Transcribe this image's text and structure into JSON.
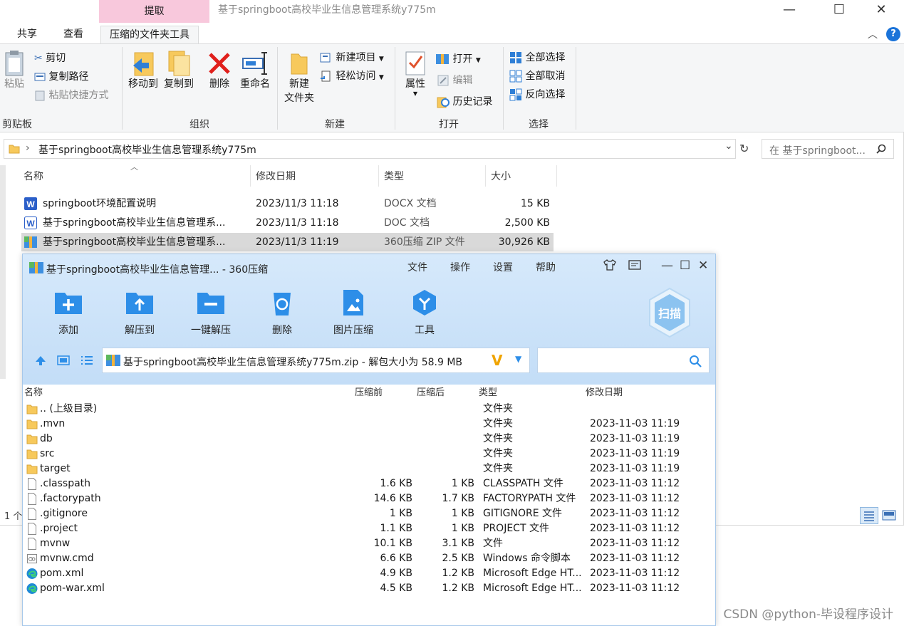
{
  "explorer": {
    "context_tab": "提取",
    "title": "基于springboot高校毕业生信息管理系统y775m",
    "tabs": [
      "共享",
      "查看",
      "压缩的文件夹工具"
    ],
    "ribbon": {
      "clipboard": {
        "label": "剪贴板",
        "paste": "粘贴",
        "cut": "剪切",
        "copy_path": "复制路径",
        "paste_shortcut": "粘贴快捷方式"
      },
      "organize": {
        "label": "组织",
        "move_to": "移动到",
        "copy_to": "复制到",
        "delete": "删除",
        "rename": "重命名"
      },
      "new": {
        "label": "新建",
        "new_folder_1": "新建",
        "new_folder_2": "文件夹",
        "new_item": "新建项目",
        "easy_access": "轻松访问"
      },
      "open": {
        "label": "打开",
        "properties": "属性",
        "open": "打开",
        "edit": "编辑",
        "history": "历史记录"
      },
      "select": {
        "label": "选择",
        "select_all": "全部选择",
        "select_none": "全部取消",
        "invert": "反向选择"
      }
    },
    "address": "基于springboot高校毕业生信息管理系统y775m",
    "search_placeholder": "在 基于springboot...",
    "columns": [
      "名称",
      "修改日期",
      "类型",
      "大小"
    ],
    "files": [
      {
        "name": "springboot环境配置说明",
        "date": "2023/11/3 11:18",
        "type": "DOCX 文档",
        "size": "15 KB"
      },
      {
        "name": "基于springboot高校毕业生信息管理系...",
        "date": "2023/11/3 11:18",
        "type": "DOC 文档",
        "size": "2,500 KB"
      },
      {
        "name": "基于springboot高校毕业生信息管理系...",
        "date": "2023/11/3 11:19",
        "type": "360压缩 ZIP 文件",
        "size": "30,926 KB"
      }
    ],
    "status": "1 个"
  },
  "zip": {
    "title": "基于springboot高校毕业生信息管理... - 360压缩",
    "menu": [
      "文件",
      "操作",
      "设置",
      "帮助"
    ],
    "tools": [
      "添加",
      "解压到",
      "一键解压",
      "删除",
      "图片压缩",
      "工具"
    ],
    "scan": "扫描",
    "path": "基于springboot高校毕业生信息管理系统y775m.zip - 解包大小为 58.9 MB",
    "columns": [
      "名称",
      "压缩前",
      "压缩后",
      "类型",
      "修改日期"
    ],
    "rows": [
      {
        "icon": "folder",
        "name": ".. (上级目录)",
        "before": "",
        "after": "",
        "type": "文件夹",
        "date": ""
      },
      {
        "icon": "folder",
        "name": ".mvn",
        "before": "",
        "after": "",
        "type": "文件夹",
        "date": "2023-11-03 11:19"
      },
      {
        "icon": "folder",
        "name": "db",
        "before": "",
        "after": "",
        "type": "文件夹",
        "date": "2023-11-03 11:19"
      },
      {
        "icon": "folder",
        "name": "src",
        "before": "",
        "after": "",
        "type": "文件夹",
        "date": "2023-11-03 11:19"
      },
      {
        "icon": "folder",
        "name": "target",
        "before": "",
        "after": "",
        "type": "文件夹",
        "date": "2023-11-03 11:19"
      },
      {
        "icon": "file",
        "name": ".classpath",
        "before": "1.6 KB",
        "after": "1 KB",
        "type": "CLASSPATH 文件",
        "date": "2023-11-03 11:12"
      },
      {
        "icon": "file",
        "name": ".factorypath",
        "before": "14.6 KB",
        "after": "1.7 KB",
        "type": "FACTORYPATH 文件",
        "date": "2023-11-03 11:12"
      },
      {
        "icon": "file",
        "name": ".gitignore",
        "before": "1 KB",
        "after": "1 KB",
        "type": "GITIGNORE 文件",
        "date": "2023-11-03 11:12"
      },
      {
        "icon": "file",
        "name": ".project",
        "before": "1.1 KB",
        "after": "1 KB",
        "type": "PROJECT 文件",
        "date": "2023-11-03 11:12"
      },
      {
        "icon": "file",
        "name": "mvnw",
        "before": "10.1 KB",
        "after": "3.1 KB",
        "type": "文件",
        "date": "2023-11-03 11:12"
      },
      {
        "icon": "cmd",
        "name": "mvnw.cmd",
        "before": "6.6 KB",
        "after": "2.5 KB",
        "type": "Windows 命令脚本",
        "date": "2023-11-03 11:12"
      },
      {
        "icon": "edge",
        "name": "pom.xml",
        "before": "4.9 KB",
        "after": "1.2 KB",
        "type": "Microsoft Edge HT...",
        "date": "2023-11-03 11:12"
      },
      {
        "icon": "edge",
        "name": "pom-war.xml",
        "before": "4.5 KB",
        "after": "1.2 KB",
        "type": "Microsoft Edge HT...",
        "date": "2023-11-03 11:12"
      }
    ]
  },
  "watermark": "CSDN @python-毕设程序设计"
}
